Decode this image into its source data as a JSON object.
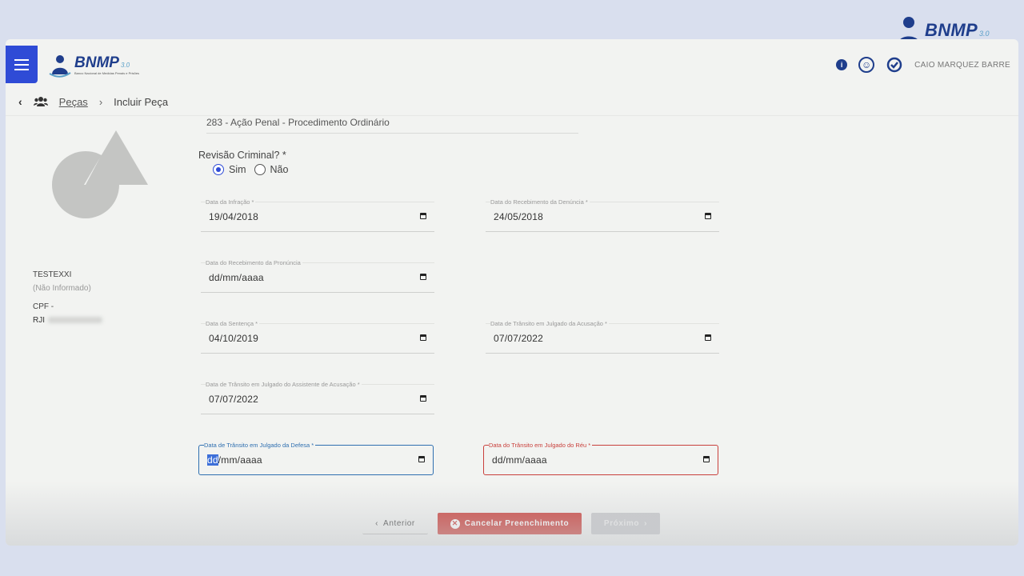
{
  "brand": {
    "name": "BNMP",
    "version": "3.0",
    "subtitle": "Banco Nacional de Medidas Penais e Prisões"
  },
  "header": {
    "info_icon": "info-icon",
    "accessibility_icon": "accessibility-icon",
    "user_icon": "user-badge-icon",
    "username": "CAIO MARQUEZ BARRE"
  },
  "breadcrumb": {
    "back_icon": "chevron-left-icon",
    "users_icon": "users-icon",
    "link": "Peças",
    "separator": "›",
    "current": "Incluir Peça"
  },
  "person": {
    "name": "TESTEXXI",
    "status": "(Não Informado)",
    "cpf_label": "CPF -",
    "rji_label": "RJI"
  },
  "form": {
    "procedure": "283 - Ação Penal - Procedimento Ordinário",
    "revisao_label": "Revisão Criminal? *",
    "radio_sim": "Sim",
    "radio_nao": "Não",
    "selected": "Sim",
    "data_infracao": {
      "label": "Data da Infração *",
      "value": "19/04/2018"
    },
    "data_recebimento_denuncia": {
      "label": "Data do Recebimento da Denúncia *",
      "value": "24/05/2018"
    },
    "data_recebimento_pronuncia": {
      "label": "Data do Recebimento da Pronúncia",
      "value": "dd/mm/aaaa"
    },
    "data_sentenca": {
      "label": "Data da Sentença *",
      "value": "04/10/2019"
    },
    "data_transito_acusacao": {
      "label": "Data de Trânsito em Julgado da Acusação *",
      "value": "07/07/2022"
    },
    "data_transito_assistente": {
      "label": "Data de Trânsito em Julgado do Assistente de Acusação *",
      "value": "07/07/2022"
    },
    "data_transito_defesa": {
      "label": "Data de Trânsito em Julgado da Defesa *",
      "value_hl": "dd",
      "value_rest": "/mm/aaaa"
    },
    "data_transito_reu": {
      "label": "Data do Trânsito em Julgado do Réu *",
      "value": "dd/mm/aaaa"
    }
  },
  "buttons": {
    "anterior": "Anterior",
    "cancelar": "Cancelar Preenchimento",
    "proximo": "Próximo"
  },
  "colors": {
    "primary": "#2f4bd6",
    "brand_blue": "#1f3e8c",
    "danger": "#cc3f3a",
    "disabled": "#c9cacc"
  }
}
